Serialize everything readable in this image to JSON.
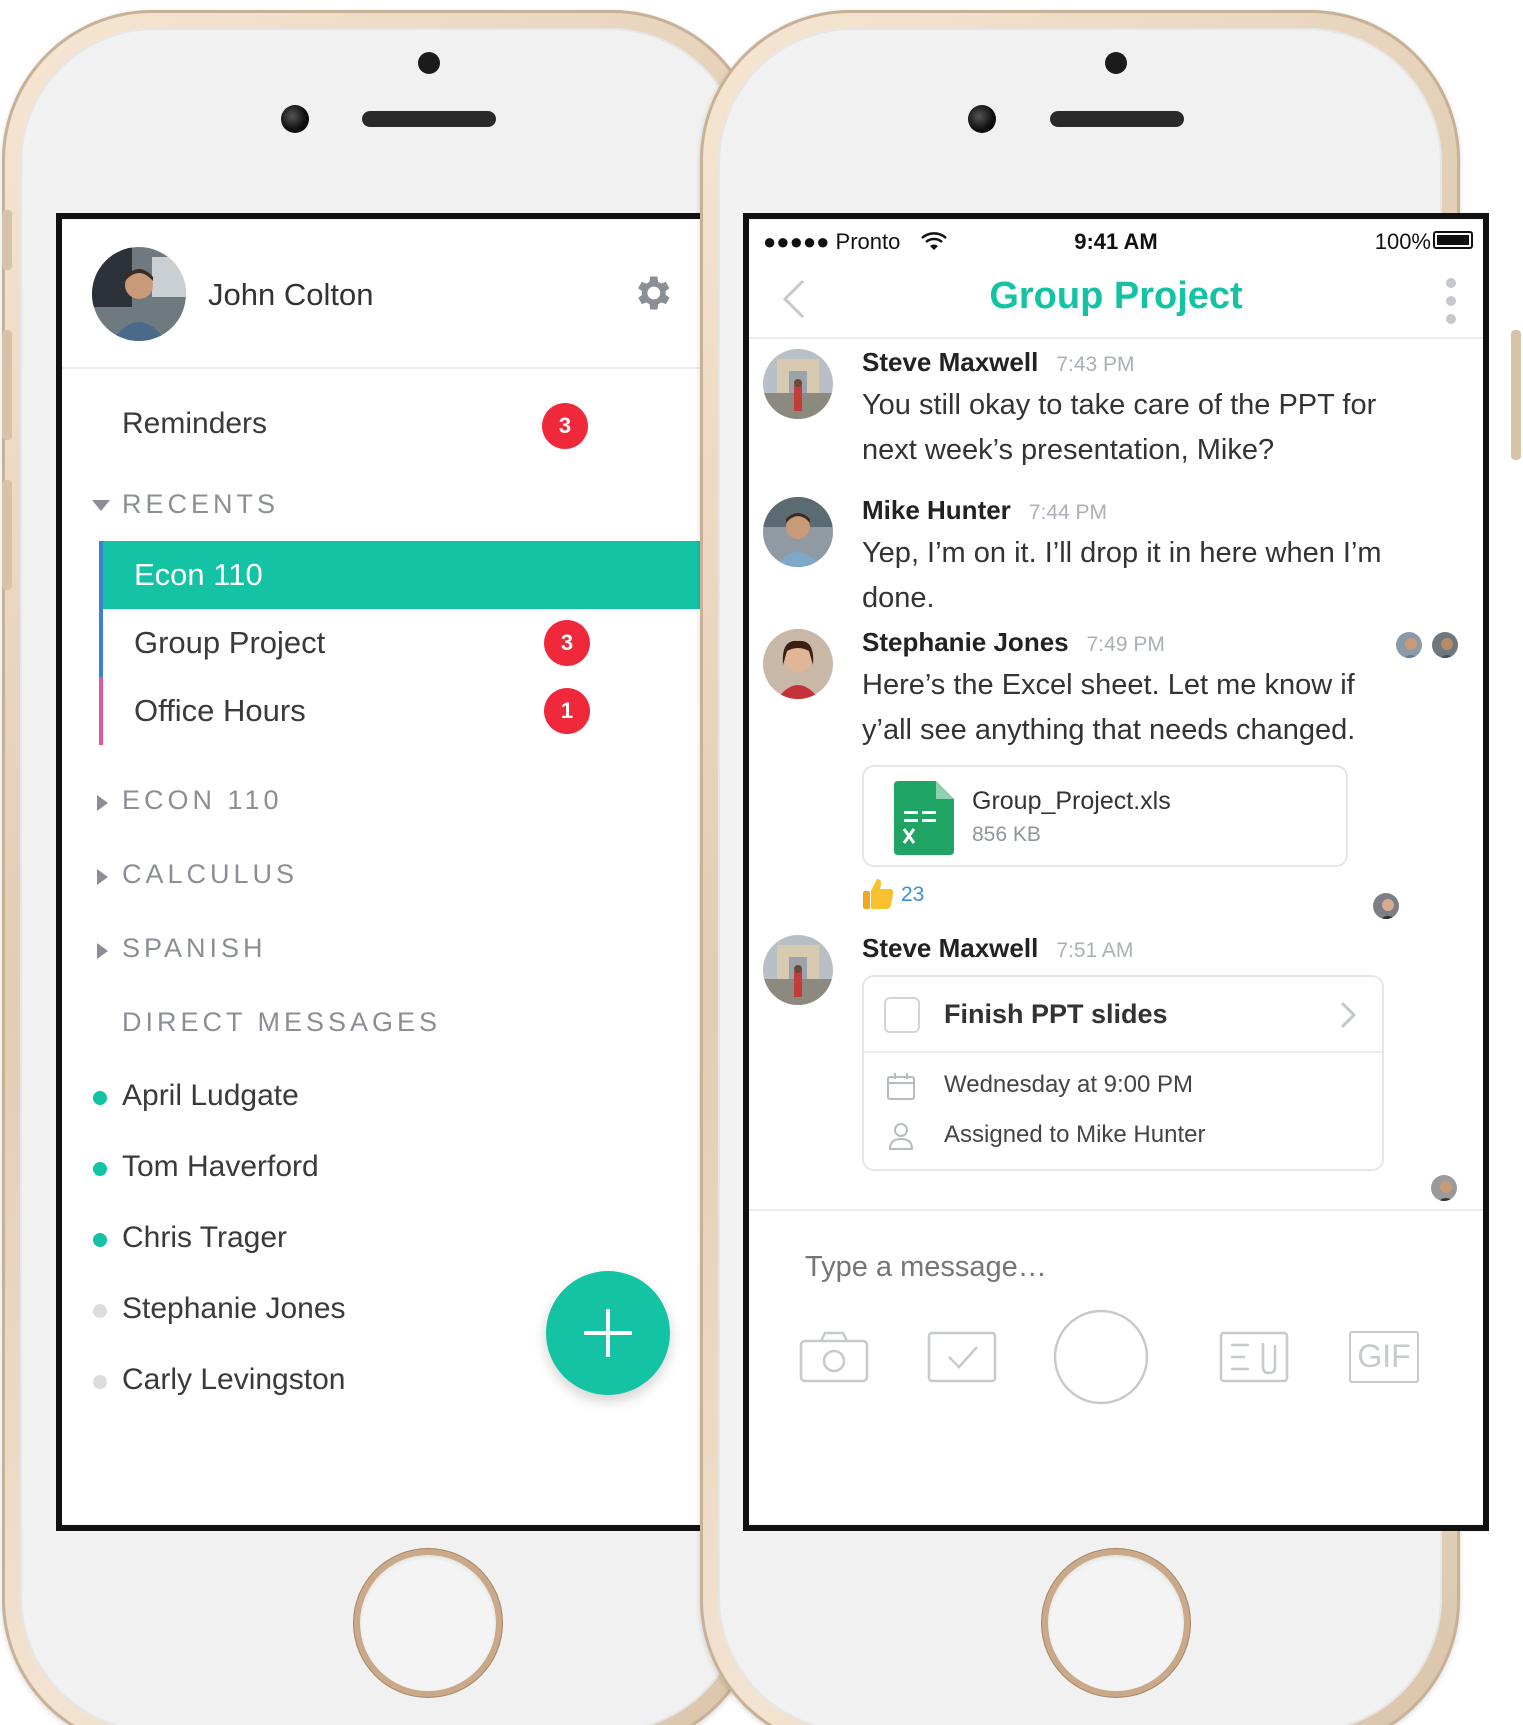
{
  "left_phone": {
    "profile": {
      "name": "John Colton"
    },
    "reminders": {
      "label": "Reminders",
      "badge": "3"
    },
    "recents": {
      "header": "RECENTS",
      "items": [
        {
          "label": "Econ 110",
          "badge": "",
          "bar_color": "#3b7fd6",
          "active": true
        },
        {
          "label": "Group Project",
          "badge": "3",
          "bar_color": "#3b7fd6",
          "active": false
        },
        {
          "label": "Office Hours",
          "badge": "1",
          "bar_color": "#e0579a",
          "active": false
        }
      ]
    },
    "sections": [
      "ECON 110",
      "CALCULUS",
      "SPANISH"
    ],
    "direct_messages": {
      "header": "DIRECT MESSAGES",
      "items": [
        {
          "name": "April Ludgate",
          "online": true
        },
        {
          "name": "Tom Haverford",
          "online": true
        },
        {
          "name": "Chris Trager",
          "online": true
        },
        {
          "name": "Stephanie Jones",
          "online": false
        },
        {
          "name": "Carly Levingston",
          "online": false
        }
      ]
    },
    "colors": {
      "accent": "#13c3a4",
      "badge": "#f0283c",
      "online": "#13c3a4",
      "offline": "#d8d8d8"
    }
  },
  "right_phone": {
    "status_bar": {
      "carrier": "●●●●● Pronto",
      "time": "9:41 AM",
      "battery": "100%"
    },
    "nav": {
      "title": "Group Project"
    },
    "messages": [
      {
        "author": "Steve Maxwell",
        "time": "7:43 PM",
        "text": "You still okay to take care of the PPT for next week’s presentation, Mike?"
      },
      {
        "author": "Mike Hunter",
        "time": "7:44 PM",
        "text": "Yep, I’m on it. I’ll drop it in here when I’m done."
      },
      {
        "author": "Stephanie Jones",
        "time": "7:49 PM",
        "text": "Here’s the Excel sheet. Let me know if y’all see anything that needs changed."
      },
      {
        "author": "Steve Maxwell",
        "time": "7:51 AM",
        "text": ""
      }
    ],
    "attachment": {
      "file_name": "Group_Project.xls",
      "file_size": "856 KB"
    },
    "reaction": {
      "emoji": "thumbs-up",
      "count": "23"
    },
    "task": {
      "title": "Finish PPT slides",
      "due": "Wednesday at 9:00 PM",
      "assignee": "Assigned to Mike Hunter"
    },
    "composer": {
      "placeholder": "Type a message…",
      "gif_label": "GIF"
    },
    "colors": {
      "accent": "#13c3a4",
      "link": "#3b8fd6",
      "sheet": "#1fa463"
    }
  }
}
